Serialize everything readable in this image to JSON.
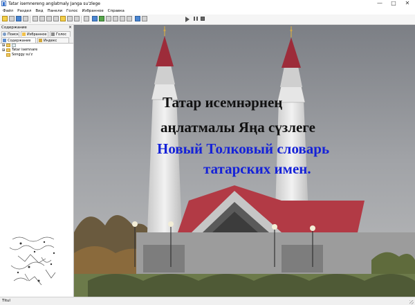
{
  "window": {
    "title": "Tatar isemnereng anglatmaly Janga su'zlege",
    "controls": {
      "minimize": "—",
      "maximize": "□",
      "close": "✕"
    }
  },
  "menu": [
    "Файл",
    "Раздел",
    "Вид",
    "Панели",
    "Голос",
    "Избранное",
    "Справка"
  ],
  "left_panel": {
    "title": "Содержание",
    "close": "×",
    "tabs_top": [
      {
        "label": "Поиск",
        "icon": "search-icon"
      },
      {
        "label": "Избранное",
        "icon": "star-icon"
      },
      {
        "label": "Голос",
        "icon": "speaker-icon"
      }
    ],
    "tabs_bottom": [
      {
        "label": "Содержание",
        "icon": "book-icon"
      },
      {
        "label": "Индекс",
        "icon": "key-icon"
      }
    ],
    "tree": [
      {
        "label": "",
        "expander": "+"
      },
      {
        "label": "Tatar isemnare",
        "expander": "+"
      },
      {
        "label": "Songgy su'z",
        "expander": ""
      }
    ]
  },
  "main": {
    "lines": [
      "Татар исемнәрнең",
      "аңлатмалы Яңа сүзлеге",
      "Новый Толковый словарь",
      "татарских имен."
    ],
    "colors": {
      "black_text": "#111111",
      "blue_text": "#1522d8"
    }
  },
  "statusbar": {
    "text": "Titul"
  }
}
